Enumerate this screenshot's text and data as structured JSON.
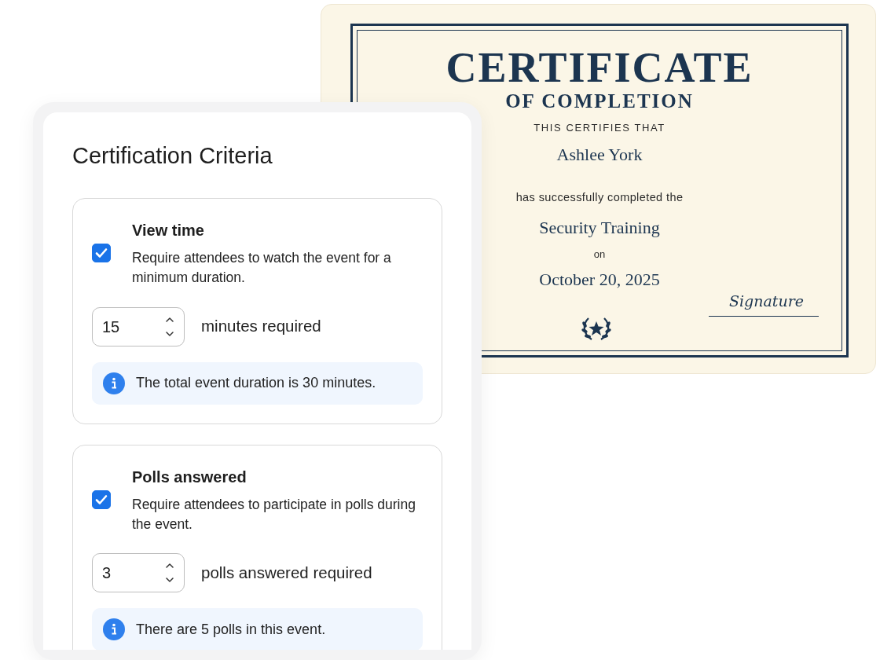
{
  "certificate": {
    "title": "CERTIFICATE",
    "subtitle": "OF COMPLETION",
    "intro": "THIS CERTIFIES THAT",
    "recipient": "Ashlee York",
    "statement": "has successfully completed the",
    "course": "Security Training",
    "date_prefix": "on",
    "date": "October 20, 2025",
    "signature": "Signature"
  },
  "panel": {
    "title": "Certification Criteria",
    "criteria": [
      {
        "title": "View time",
        "checked": true,
        "description": "Require attendees to watch the event for a minimum duration.",
        "value": "15",
        "unit": "minutes required",
        "info": "The total event duration is 30 minutes."
      },
      {
        "title": "Polls answered",
        "checked": true,
        "description": "Require attendees to participate in polls during the event.",
        "value": "3",
        "unit": "polls answered required",
        "info": "There are 5 polls in this event."
      }
    ]
  }
}
